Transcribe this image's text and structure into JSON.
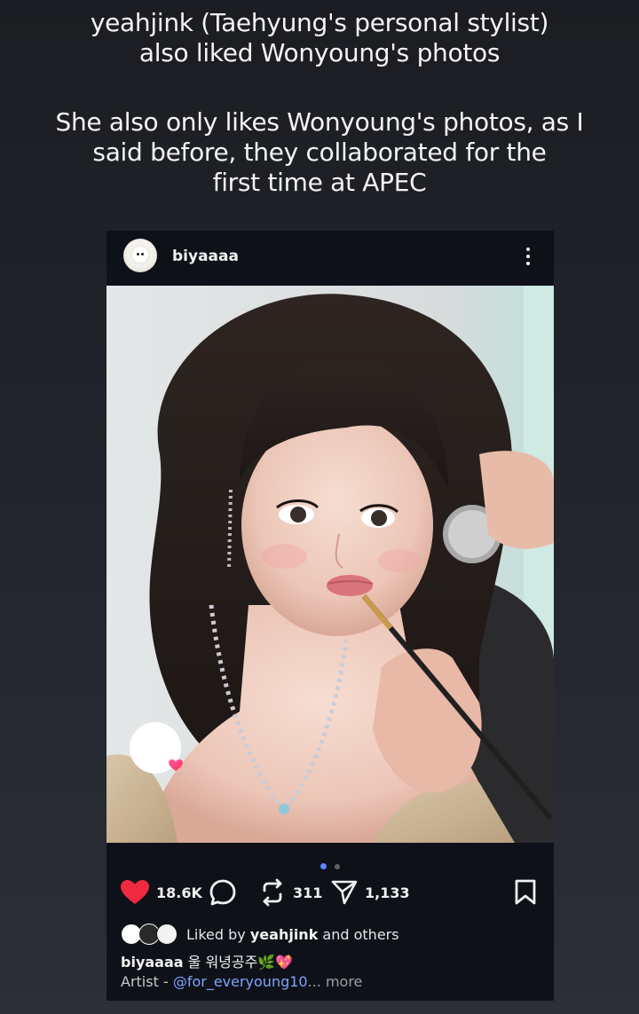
{
  "caption": {
    "paragraph1": [
      "yeahjink (Taehyung's personal stylist)",
      "also liked Wonyoung's photos"
    ],
    "paragraph2": [
      "She also only likes Wonyoung's photos, as I",
      "said before, they collaborated for the",
      "first time at APEC"
    ]
  },
  "post": {
    "username": "biyaaaa",
    "avatar_icon": "poodle-dog-avatar",
    "more_icon": "three-dots-vertical-icon",
    "carousel": {
      "total": 2,
      "current": 1
    },
    "actions": {
      "likes": "18.6K",
      "reposts": "311",
      "shares": "1,133"
    },
    "liked_by": {
      "prefix": "Liked by",
      "user": "yeahjink",
      "suffix": "and others"
    },
    "caption_user": "biyaaaa",
    "caption_text": "울 워녕공주",
    "caption_emojis": [
      "🌿",
      "💖"
    ],
    "artist_prefix": "Artist -",
    "artist_mention": "@for_everyoung10",
    "more_label": "... more"
  },
  "colors": {
    "like_red": "#ef2a40",
    "accent_blue": "#5a86ff",
    "mention_blue": "#7fa4ff",
    "post_bg": "#0e1117"
  }
}
